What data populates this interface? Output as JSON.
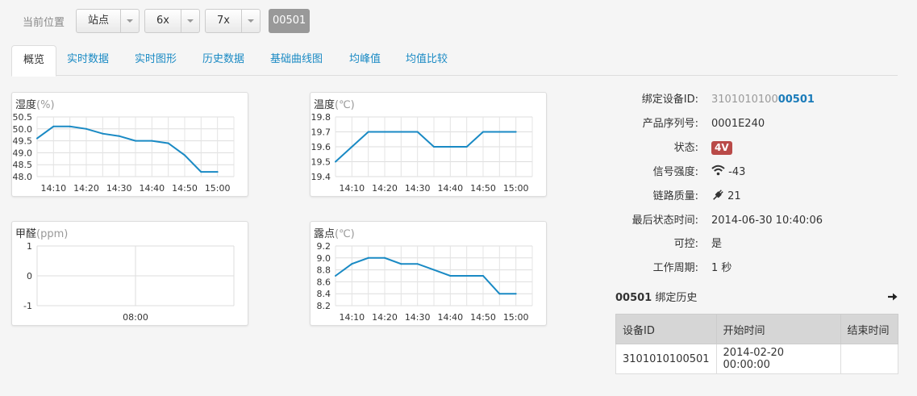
{
  "breadcrumb": {
    "label": "当前位置",
    "selects": [
      "站点",
      "6x",
      "7x"
    ],
    "current": "00501"
  },
  "tabs": [
    "概览",
    "实时数据",
    "实时图形",
    "历史数据",
    "基础曲线图",
    "均峰值",
    "均值比较"
  ],
  "colors": {
    "line": "#1a8ac4",
    "link": "#1a8ac4",
    "badge": "#b94a48"
  },
  "chart_data": [
    {
      "type": "line",
      "title": "湿度",
      "unit": "(%)",
      "x": [
        "14:05",
        "14:10",
        "14:15",
        "14:20",
        "14:25",
        "14:30",
        "14:35",
        "14:40",
        "14:45",
        "14:50",
        "14:55",
        "15:00",
        "15:05"
      ],
      "x_ticks": [
        "14:10",
        "14:20",
        "14:30",
        "14:40",
        "14:50",
        "15:00"
      ],
      "y_ticks": [
        "50.5",
        "50.0",
        "49.5",
        "49.0",
        "48.5",
        "48.0"
      ],
      "ylim": [
        48.0,
        50.5
      ],
      "series": [
        {
          "values": [
            49.6,
            50.1,
            50.1,
            50.0,
            49.8,
            49.7,
            49.5,
            49.5,
            49.4,
            48.9,
            48.2,
            48.2
          ]
        }
      ]
    },
    {
      "type": "line",
      "title": "温度",
      "unit": "(℃)",
      "x": [
        "14:05",
        "14:10",
        "14:15",
        "14:20",
        "14:25",
        "14:30",
        "14:35",
        "14:40",
        "14:45",
        "14:50",
        "14:55",
        "15:00",
        "15:05"
      ],
      "x_ticks": [
        "14:10",
        "14:20",
        "14:30",
        "14:40",
        "14:50",
        "15:00"
      ],
      "y_ticks": [
        "19.8",
        "19.7",
        "19.6",
        "19.5",
        "19.4"
      ],
      "ylim": [
        19.4,
        19.8
      ],
      "series": [
        {
          "values": [
            19.5,
            19.6,
            19.7,
            19.7,
            19.7,
            19.7,
            19.6,
            19.6,
            19.6,
            19.7,
            19.7,
            19.7
          ]
        }
      ]
    },
    {
      "type": "line",
      "title": "甲醛",
      "unit": "(ppm)",
      "x_ticks": [
        "08:00"
      ],
      "y_ticks": [
        "1",
        "0",
        "-1"
      ],
      "ylim": [
        -1,
        1
      ],
      "series": []
    },
    {
      "type": "line",
      "title": "露点",
      "unit": "(℃)",
      "x": [
        "14:05",
        "14:10",
        "14:15",
        "14:20",
        "14:25",
        "14:30",
        "14:35",
        "14:40",
        "14:45",
        "14:50",
        "14:55",
        "15:00",
        "15:05"
      ],
      "x_ticks": [
        "14:10",
        "14:20",
        "14:30",
        "14:40",
        "14:50",
        "15:00"
      ],
      "y_ticks": [
        "9.2",
        "9.0",
        "8.8",
        "8.6",
        "8.4",
        "8.2"
      ],
      "ylim": [
        8.2,
        9.2
      ],
      "series": [
        {
          "values": [
            8.7,
            8.9,
            9.0,
            9.0,
            8.9,
            8.9,
            8.8,
            8.7,
            8.7,
            8.7,
            8.4,
            8.4
          ]
        }
      ]
    }
  ],
  "info": {
    "device_id_label": "绑定设备ID:",
    "device_id_prefix": "3101010100",
    "device_id_suffix": "00501",
    "serial_label": "产品序列号:",
    "serial_value": "0001E240",
    "status_label": "状态:",
    "status_value": "4V",
    "signal_label": "信号强度:",
    "signal_icon": "wifi-icon",
    "signal_value": "-43",
    "link_label": "链路质量:",
    "link_icon": "plug-icon",
    "link_value": "21",
    "last_time_label": "最后状态时间:",
    "last_time_value": "2014-06-30 10:40:06",
    "control_label": "可控:",
    "control_value": "是",
    "cycle_label": "工作周期:",
    "cycle_value": "1 秒"
  },
  "history": {
    "title_id": "00501",
    "title_text": " 绑定历史",
    "columns": [
      "设备ID",
      "开始时间",
      "结束时间"
    ],
    "rows": [
      [
        "3101010100501",
        "2014-02-20 00:00:00",
        ""
      ]
    ]
  }
}
